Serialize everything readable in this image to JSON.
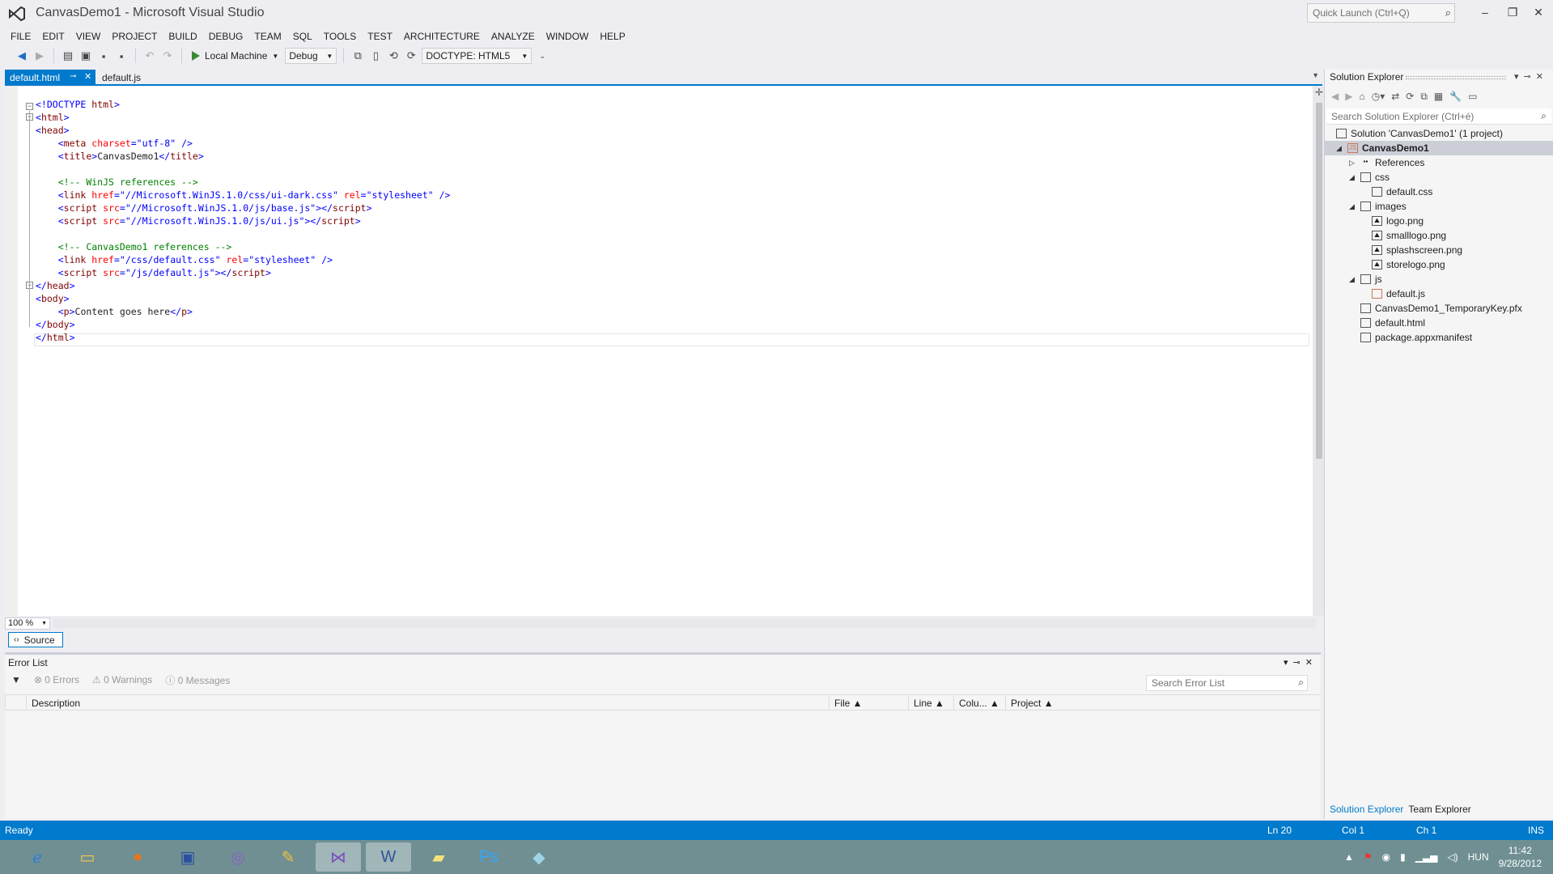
{
  "window": {
    "title": "CanvasDemo1 - Microsoft Visual Studio",
    "quick_launch_placeholder": "Quick Launch (Ctrl+Q)"
  },
  "menu": [
    "FILE",
    "EDIT",
    "VIEW",
    "PROJECT",
    "BUILD",
    "DEBUG",
    "TEAM",
    "SQL",
    "TOOLS",
    "TEST",
    "ARCHITECTURE",
    "ANALYZE",
    "WINDOW",
    "HELP"
  ],
  "toolbar": {
    "run_target": "Local Machine",
    "configuration": "Debug",
    "doctype": "DOCTYPE: HTML5"
  },
  "tabs": {
    "active": "default.html",
    "second": "default.js"
  },
  "editor": {
    "zoom": "100 %",
    "view_tab": "Source"
  },
  "error_list": {
    "title": "Error List",
    "errors": "0 Errors",
    "warnings": "0 Warnings",
    "messages": "0 Messages",
    "search_placeholder": "Search Error List",
    "columns": {
      "description": "Description",
      "file": "File",
      "line": "Line",
      "column": "Colu...",
      "project": "Project"
    }
  },
  "solution_explorer": {
    "title": "Solution Explorer",
    "search_placeholder": "Search Solution Explorer (Ctrl+é)",
    "tree": {
      "solution": "Solution 'CanvasDemo1' (1 project)",
      "project": "CanvasDemo1",
      "references": "References",
      "css": "css",
      "default_css": "default.css",
      "images": "images",
      "logo": "logo.png",
      "smalllogo": "smalllogo.png",
      "splashscreen": "splashscreen.png",
      "storelogo": "storelogo.png",
      "js": "js",
      "default_js": "default.js",
      "pfx": "CanvasDemo1_TemporaryKey.pfx",
      "default_html": "default.html",
      "manifest": "package.appxmanifest"
    },
    "tab_solution": "Solution Explorer",
    "tab_team": "Team Explorer"
  },
  "status": {
    "state": "Ready",
    "line": "Ln 20",
    "col": "Col 1",
    "ch": "Ch 1",
    "mode": "INS"
  },
  "taskbar": {
    "language": "HUN",
    "time": "11:42",
    "date": "9/28/2012"
  },
  "colors": {
    "accent": "#007acc",
    "tag": "#800000",
    "attr": "#ff0000",
    "value": "#0000ff",
    "comment": "#008000"
  }
}
